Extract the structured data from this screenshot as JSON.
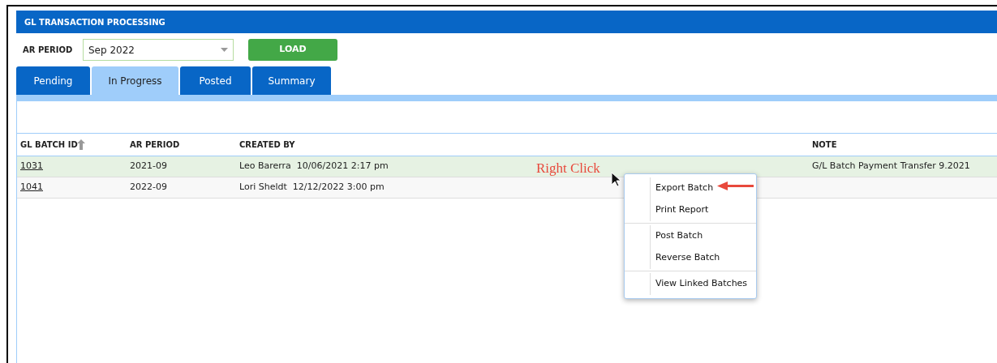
{
  "window": {
    "title": "GL TRANSACTION PROCESSING"
  },
  "filter": {
    "label": "AR PERIOD",
    "value": "Sep 2022",
    "button": "LOAD"
  },
  "tabs": [
    {
      "label": "Pending",
      "selected": false
    },
    {
      "label": "In Progress",
      "selected": true
    },
    {
      "label": "Posted",
      "selected": false
    },
    {
      "label": "Summary",
      "selected": false
    }
  ],
  "table": {
    "columns": [
      "GL BATCH ID",
      "AR PERIOD",
      "CREATED BY",
      "NOTE"
    ],
    "rows": [
      {
        "id": "1031",
        "period": "2021-09",
        "created_by": "Leo Barerra  10/06/2021 2:17 pm",
        "note": "G/L Batch Payment Transfer 9.2021",
        "selected": true
      },
      {
        "id": "1041",
        "period": "2022-09",
        "created_by": "Lori Sheldt  12/12/2022 3:00 pm",
        "selected": false
      }
    ]
  },
  "annotation": "Right Click",
  "context_menu": {
    "groups": [
      [
        "Export Batch",
        "Print Report"
      ],
      [
        "Post Batch",
        "Reverse Batch"
      ],
      [
        "View Linked Batches"
      ]
    ]
  }
}
